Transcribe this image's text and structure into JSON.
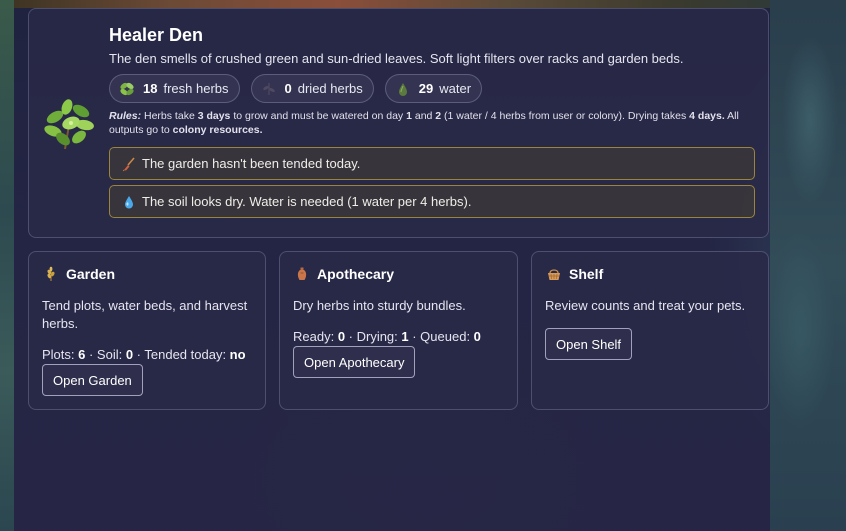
{
  "den": {
    "title": "Healer Den",
    "description": "The den smells of crushed green and sun-dried leaves. Soft light filters over racks and garden beds.",
    "chips": [
      {
        "icon": "herb-leaves-icon",
        "value": "18",
        "label": "fresh herbs"
      },
      {
        "icon": "dried-herbs-icon",
        "value": "0",
        "label": "dried herbs"
      },
      {
        "icon": "water-icon",
        "value": "29",
        "label": "water"
      }
    ],
    "rules": {
      "label": "Rules:",
      "t1": " Herbs take ",
      "b1": "3 days",
      "t2": " to grow and must be watered on day ",
      "b2": "1",
      "t3": " and ",
      "b3": "2",
      "t4": " (1 water / 4 herbs from user or colony). Drying takes ",
      "b4": "4 days.",
      "t5": " All outputs go to ",
      "b5": "colony resources."
    },
    "notices": [
      {
        "icon": "broom-icon",
        "text": "The garden hasn't been tended today."
      },
      {
        "icon": "water-drop-icon",
        "text": "The soil looks dry. Water is needed (1 water per 4 herbs)."
      }
    ]
  },
  "cards": {
    "garden": {
      "icon": "wheat-icon",
      "title": "Garden",
      "description": "Tend plots, water beds, and harvest herbs.",
      "stats": {
        "plots_label": "Plots: ",
        "plots": "6",
        "soil_label": " · Soil: ",
        "soil": "0",
        "tended_label": " · Tended today: ",
        "tended": "no"
      },
      "button": "Open Garden"
    },
    "apothecary": {
      "icon": "amphora-icon",
      "title": "Apothecary",
      "description": "Dry herbs into sturdy bundles.",
      "stats": {
        "ready_label": "Ready: ",
        "ready": "0",
        "drying_label": " · Drying: ",
        "drying": "1",
        "queued_label": " · Queued: ",
        "queued": "0"
      },
      "button": "Open Apothecary"
    },
    "shelf": {
      "icon": "basket-icon",
      "title": "Shelf",
      "description": "Review counts and treat your pets.",
      "button": "Open Shelf"
    }
  },
  "colors": {
    "panel": "#2a2a48",
    "notice_border": "#bea03c",
    "text": "#e9e8f2"
  }
}
